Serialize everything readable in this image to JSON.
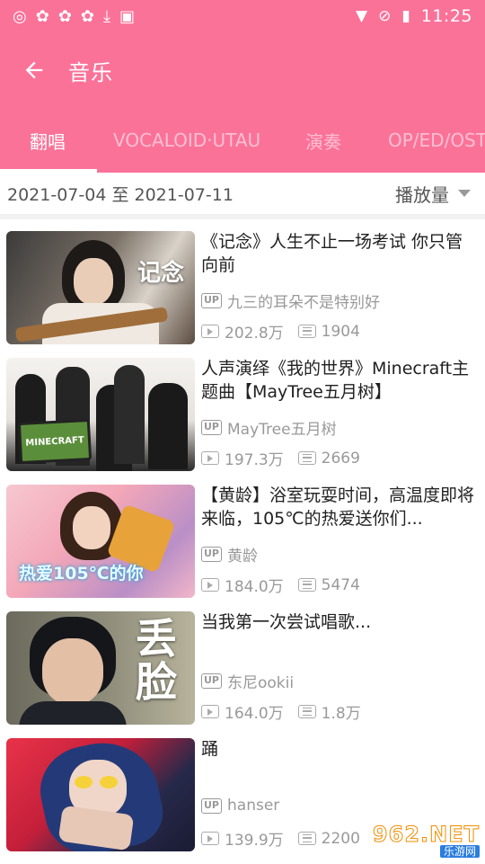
{
  "status": {
    "time": "11:25"
  },
  "appbar": {
    "title": "音乐"
  },
  "tabs": [
    {
      "label": "翻唱"
    },
    {
      "label": "VOCALOID·UTAU"
    },
    {
      "label": "演奏"
    },
    {
      "label": "OP/ED/OST"
    }
  ],
  "filter": {
    "date_range": "2021-07-04 至 2021-07-11",
    "sort_label": "播放量"
  },
  "videos": [
    {
      "title": "《记念》人生不止一场考试 你只管向前",
      "up": "九三的耳朵不是特别好",
      "plays": "202.8万",
      "danmaku": "1904",
      "thumb_text": "记念"
    },
    {
      "title": "人声演绎《我的世界》Minecraft主题曲【MayTree五月树】",
      "up": "MayTree五月树",
      "plays": "197.3万",
      "danmaku": "2669",
      "thumb_text": "MINECRAFT"
    },
    {
      "title": "【黄龄】浴室玩耍时间，高温度即将来临，105℃的热爱送你们...",
      "up": "黄龄",
      "plays": "184.0万",
      "danmaku": "5474",
      "thumb_text": "热爱105℃的你"
    },
    {
      "title": "当我第一次尝试唱歌...",
      "up": "东尼ookii",
      "plays": "164.0万",
      "danmaku": "1.8万",
      "thumb_text": "丢脸"
    },
    {
      "title": "踊",
      "up": "hanser",
      "plays": "139.9万",
      "danmaku": "2200",
      "thumb_text": ""
    }
  ],
  "watermark": {
    "line1": "962.NET",
    "line2": "乐游网"
  }
}
